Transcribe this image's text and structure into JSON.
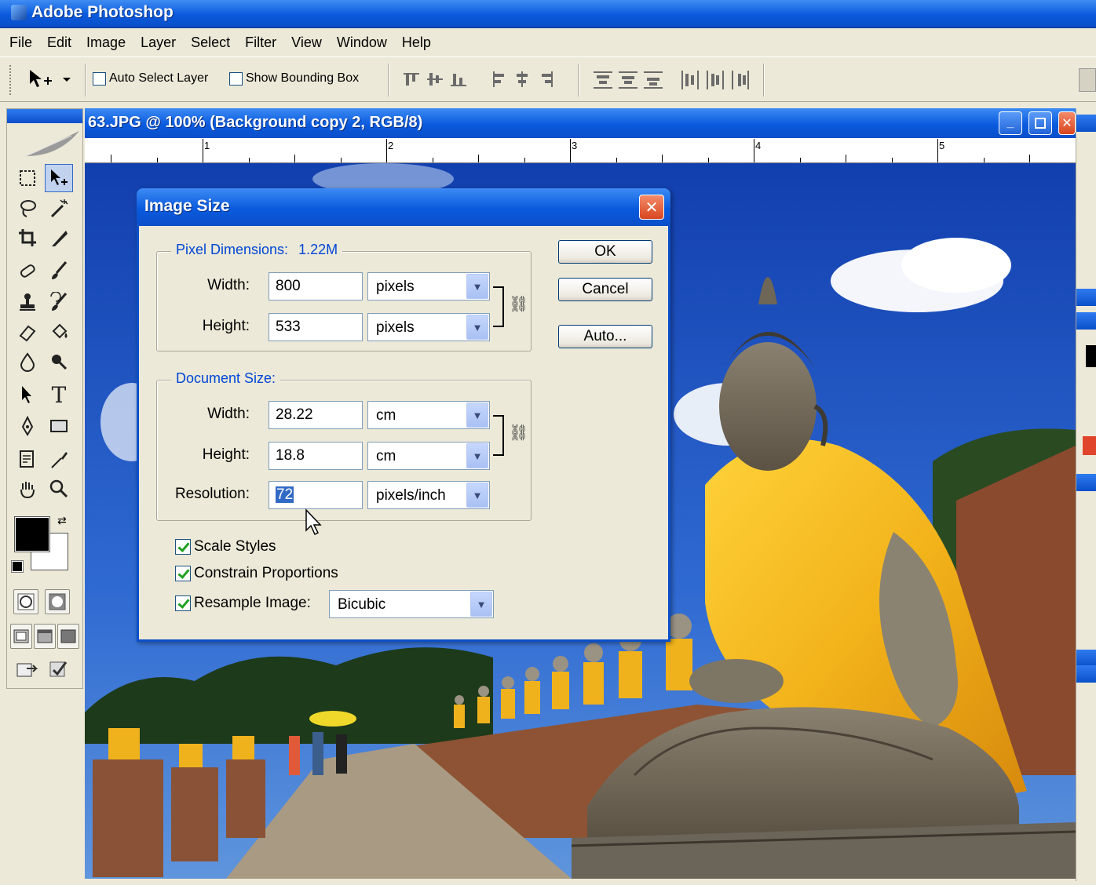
{
  "app": {
    "title": "Adobe Photoshop",
    "menu": [
      "File",
      "Edit",
      "Image",
      "Layer",
      "Select",
      "Filter",
      "View",
      "Window",
      "Help"
    ]
  },
  "options_bar": {
    "auto_select_layer": {
      "label": "Auto Select Layer",
      "checked": false
    },
    "show_bounding_box": {
      "label": "Show Bounding Box",
      "checked": false
    }
  },
  "toolbox": {
    "tools": [
      "marquee-tool",
      "move-tool",
      "lasso-tool",
      "magic-wand-tool",
      "crop-tool",
      "slice-tool",
      "healing-brush-tool",
      "brush-tool",
      "clone-stamp-tool",
      "history-brush-tool",
      "eraser-tool",
      "paint-bucket-tool",
      "blur-tool",
      "dodge-tool",
      "path-selection-tool",
      "type-tool",
      "pen-tool",
      "rectangle-tool",
      "notes-tool",
      "eyedropper-tool",
      "hand-tool",
      "zoom-tool"
    ],
    "foreground_color": "#000000",
    "background_color": "#ffffff"
  },
  "document": {
    "title": "63.JPG @ 100% (Background copy 2, RGB/8)",
    "ruler_labels": [
      "1",
      "2",
      "3",
      "4",
      "5"
    ]
  },
  "dialog": {
    "title": "Image Size",
    "pixel_dimensions": {
      "label": "Pixel Dimensions:",
      "size": "1.22M",
      "width_label": "Width:",
      "width": "800",
      "width_unit": "pixels",
      "height_label": "Height:",
      "height": "533",
      "height_unit": "pixels"
    },
    "document_size": {
      "label": "Document Size:",
      "width_label": "Width:",
      "width": "28.22",
      "width_unit": "cm",
      "height_label": "Height:",
      "height": "18.8",
      "height_unit": "cm",
      "resolution_label": "Resolution:",
      "resolution": "72",
      "resolution_unit": "pixels/inch"
    },
    "options": {
      "scale_styles": {
        "label": "Scale Styles",
        "checked": true
      },
      "constrain_proportions": {
        "label": "Constrain Proportions",
        "checked": true
      },
      "resample_image": {
        "label": "Resample Image:",
        "checked": true,
        "method": "Bicubic"
      }
    },
    "buttons": {
      "ok": "OK",
      "cancel": "Cancel",
      "auto": "Auto..."
    }
  },
  "colors": {
    "xp_blue": "#0a5ade",
    "dialog_bg": "#ece9d8",
    "group_label": "#0046d5",
    "selection": "#316ac5"
  }
}
